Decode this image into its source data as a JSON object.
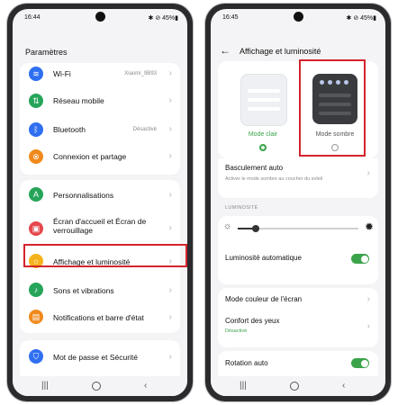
{
  "left_phone": {
    "status": {
      "time": "16:44",
      "right": "✱ ⊘ 45%▮"
    },
    "title": "Paramètres",
    "group1": [
      {
        "label": "Wi-Fi",
        "value": "Xiaomi_9B93",
        "icon": "wifi-icon",
        "color": "#2f6ff1"
      },
      {
        "label": "Réseau mobile",
        "value": "",
        "icon": "signal-icon",
        "color": "#26a55a"
      },
      {
        "label": "Bluetooth",
        "value": "Désactivé",
        "icon": "bluetooth-icon",
        "color": "#2f6ff1"
      },
      {
        "label": "Connexion et partage",
        "value": "",
        "icon": "share-icon",
        "color": "#f08a1c"
      }
    ],
    "group2": [
      {
        "label": "Personnalisations",
        "icon": "brush-icon",
        "color": "#26a55a"
      },
      {
        "label": "Écran d'accueil et Écran de verrouillage",
        "icon": "image-icon",
        "color": "#e5484d"
      },
      {
        "label": "Affichage et luminosité",
        "icon": "sun-icon",
        "color": "#f6b21a"
      },
      {
        "label": "Sons et vibrations",
        "icon": "vibrate-icon",
        "color": "#26a55a"
      },
      {
        "label": "Notifications et barre d'état",
        "icon": "notification-icon",
        "color": "#f08a1c"
      }
    ],
    "group3": [
      {
        "label": "Mot de passe et Sécurité",
        "icon": "shield-icon",
        "color": "#2f6ff1"
      }
    ]
  },
  "right_phone": {
    "status": {
      "time": "16:45",
      "right": "✱ ⊘ 45%▮"
    },
    "title": "Affichage et luminosité",
    "themes": {
      "light_label": "Mode clair",
      "dark_label": "Mode sombre",
      "selected": "light"
    },
    "basculement": {
      "label": "Basculement auto",
      "sub": "Activer le mode sombre au coucher du soleil"
    },
    "section_luminosite": "LUMINOSITÉ",
    "brightness_level": 0.15,
    "auto_brightness": {
      "label": "Luminosité automatique",
      "on": true
    },
    "color_mode": {
      "label": "Mode couleur de l'écran"
    },
    "eye_comfort": {
      "label": "Confort des yeux",
      "sub": "Désactivé"
    },
    "auto_rotate": {
      "label": "Rotation auto",
      "on": true
    }
  },
  "colors": {
    "accent": "#3ba34a",
    "highlight": "#d4242c"
  }
}
